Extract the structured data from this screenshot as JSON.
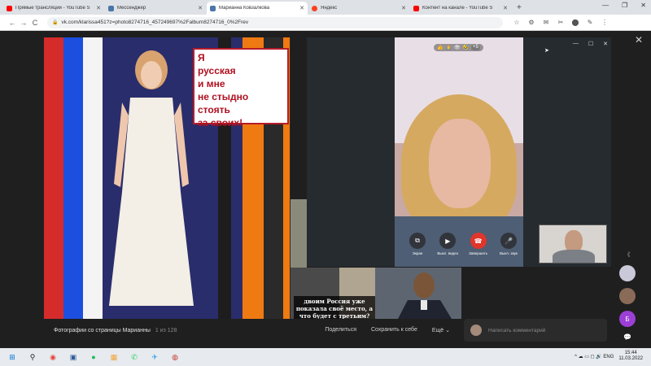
{
  "browser": {
    "tabs": [
      {
        "title": "Прямые трансляции - YouTube S",
        "favicon_color": "#ff0000",
        "active": false
      },
      {
        "title": "Мессенджер",
        "favicon_color": "#4a76a8",
        "active": false
      },
      {
        "title": "Марианна Ковзалкова",
        "favicon_color": "#4a76a8",
        "active": true
      },
      {
        "title": "Яндекс",
        "favicon_color": "#fc3f1d",
        "active": false
      },
      {
        "title": "Контент на канале - YouTube S",
        "favicon_color": "#ff0000",
        "active": false
      }
    ],
    "new_tab": "+",
    "window_controls": {
      "minimize": "—",
      "maximize": "❐",
      "close": "✕"
    },
    "nav": {
      "back": "←",
      "forward": "→",
      "reload": "C"
    },
    "url": "vk.com/klarissa451?z=photo8274716_457249697%2Falbum8274716_0%2Frev",
    "extensions": [
      "☆",
      "⚙",
      "✉",
      "✂",
      "⬤",
      "✎",
      "⋮"
    ]
  },
  "viewer": {
    "close": "✕",
    "photo_caption": "Я\nрусская\nи мне\nне стыдно\nстоять\nза своих!",
    "collage_caption": "двоим Россия уже показала своё место, а что будет с третьим?",
    "info": {
      "album": "Фотографии со страницы Марианны",
      "counter": "1 из 128",
      "share": "Поделиться",
      "save": "Сохранить к себе",
      "more": "Ещё ⌄"
    },
    "comment_placeholder": "Написать комментарий",
    "rail": {
      "chevron": "《",
      "letter": "Б",
      "message_icon": "💬"
    }
  },
  "call": {
    "window_controls": {
      "minimize": "—",
      "maximize": "☐",
      "close": "✕"
    },
    "reactions": {
      "icons": [
        "👍",
        "🙏",
        "👁",
        "🤣"
      ],
      "count": "+5"
    },
    "controls": [
      {
        "icon": "⧉",
        "label": "Экран",
        "red": false
      },
      {
        "icon": "▶",
        "label": "Выкл. видео",
        "red": false
      },
      {
        "icon": "☎",
        "label": "Завершить",
        "red": true
      },
      {
        "icon": "🎤",
        "label": "Выкл. звук",
        "red": false
      }
    ]
  },
  "taskbar": {
    "icons": [
      {
        "name": "windows-start-icon",
        "glyph": "⊞",
        "color": "#0078d7"
      },
      {
        "name": "search-icon",
        "glyph": "⚲",
        "color": "#222"
      },
      {
        "name": "chrome-icon",
        "glyph": "◉",
        "color": "#e8453c"
      },
      {
        "name": "save-app-icon",
        "glyph": "▣",
        "color": "#2b5797"
      },
      {
        "name": "spotify-icon",
        "glyph": "●",
        "color": "#1db954"
      },
      {
        "name": "media-icon",
        "glyph": "▦",
        "color": "#f2a33a"
      },
      {
        "name": "whatsapp-icon",
        "glyph": "✆",
        "color": "#25d366"
      },
      {
        "name": "telegram-icon",
        "glyph": "✈",
        "color": "#2ca5e0"
      },
      {
        "name": "obs-icon",
        "glyph": "◍",
        "color": "#c0392b"
      }
    ],
    "tray": {
      "icons": "^ ☁ ▭ ◻ 🔊 ENG",
      "time": "15:44",
      "date": "11.03.2022"
    }
  }
}
